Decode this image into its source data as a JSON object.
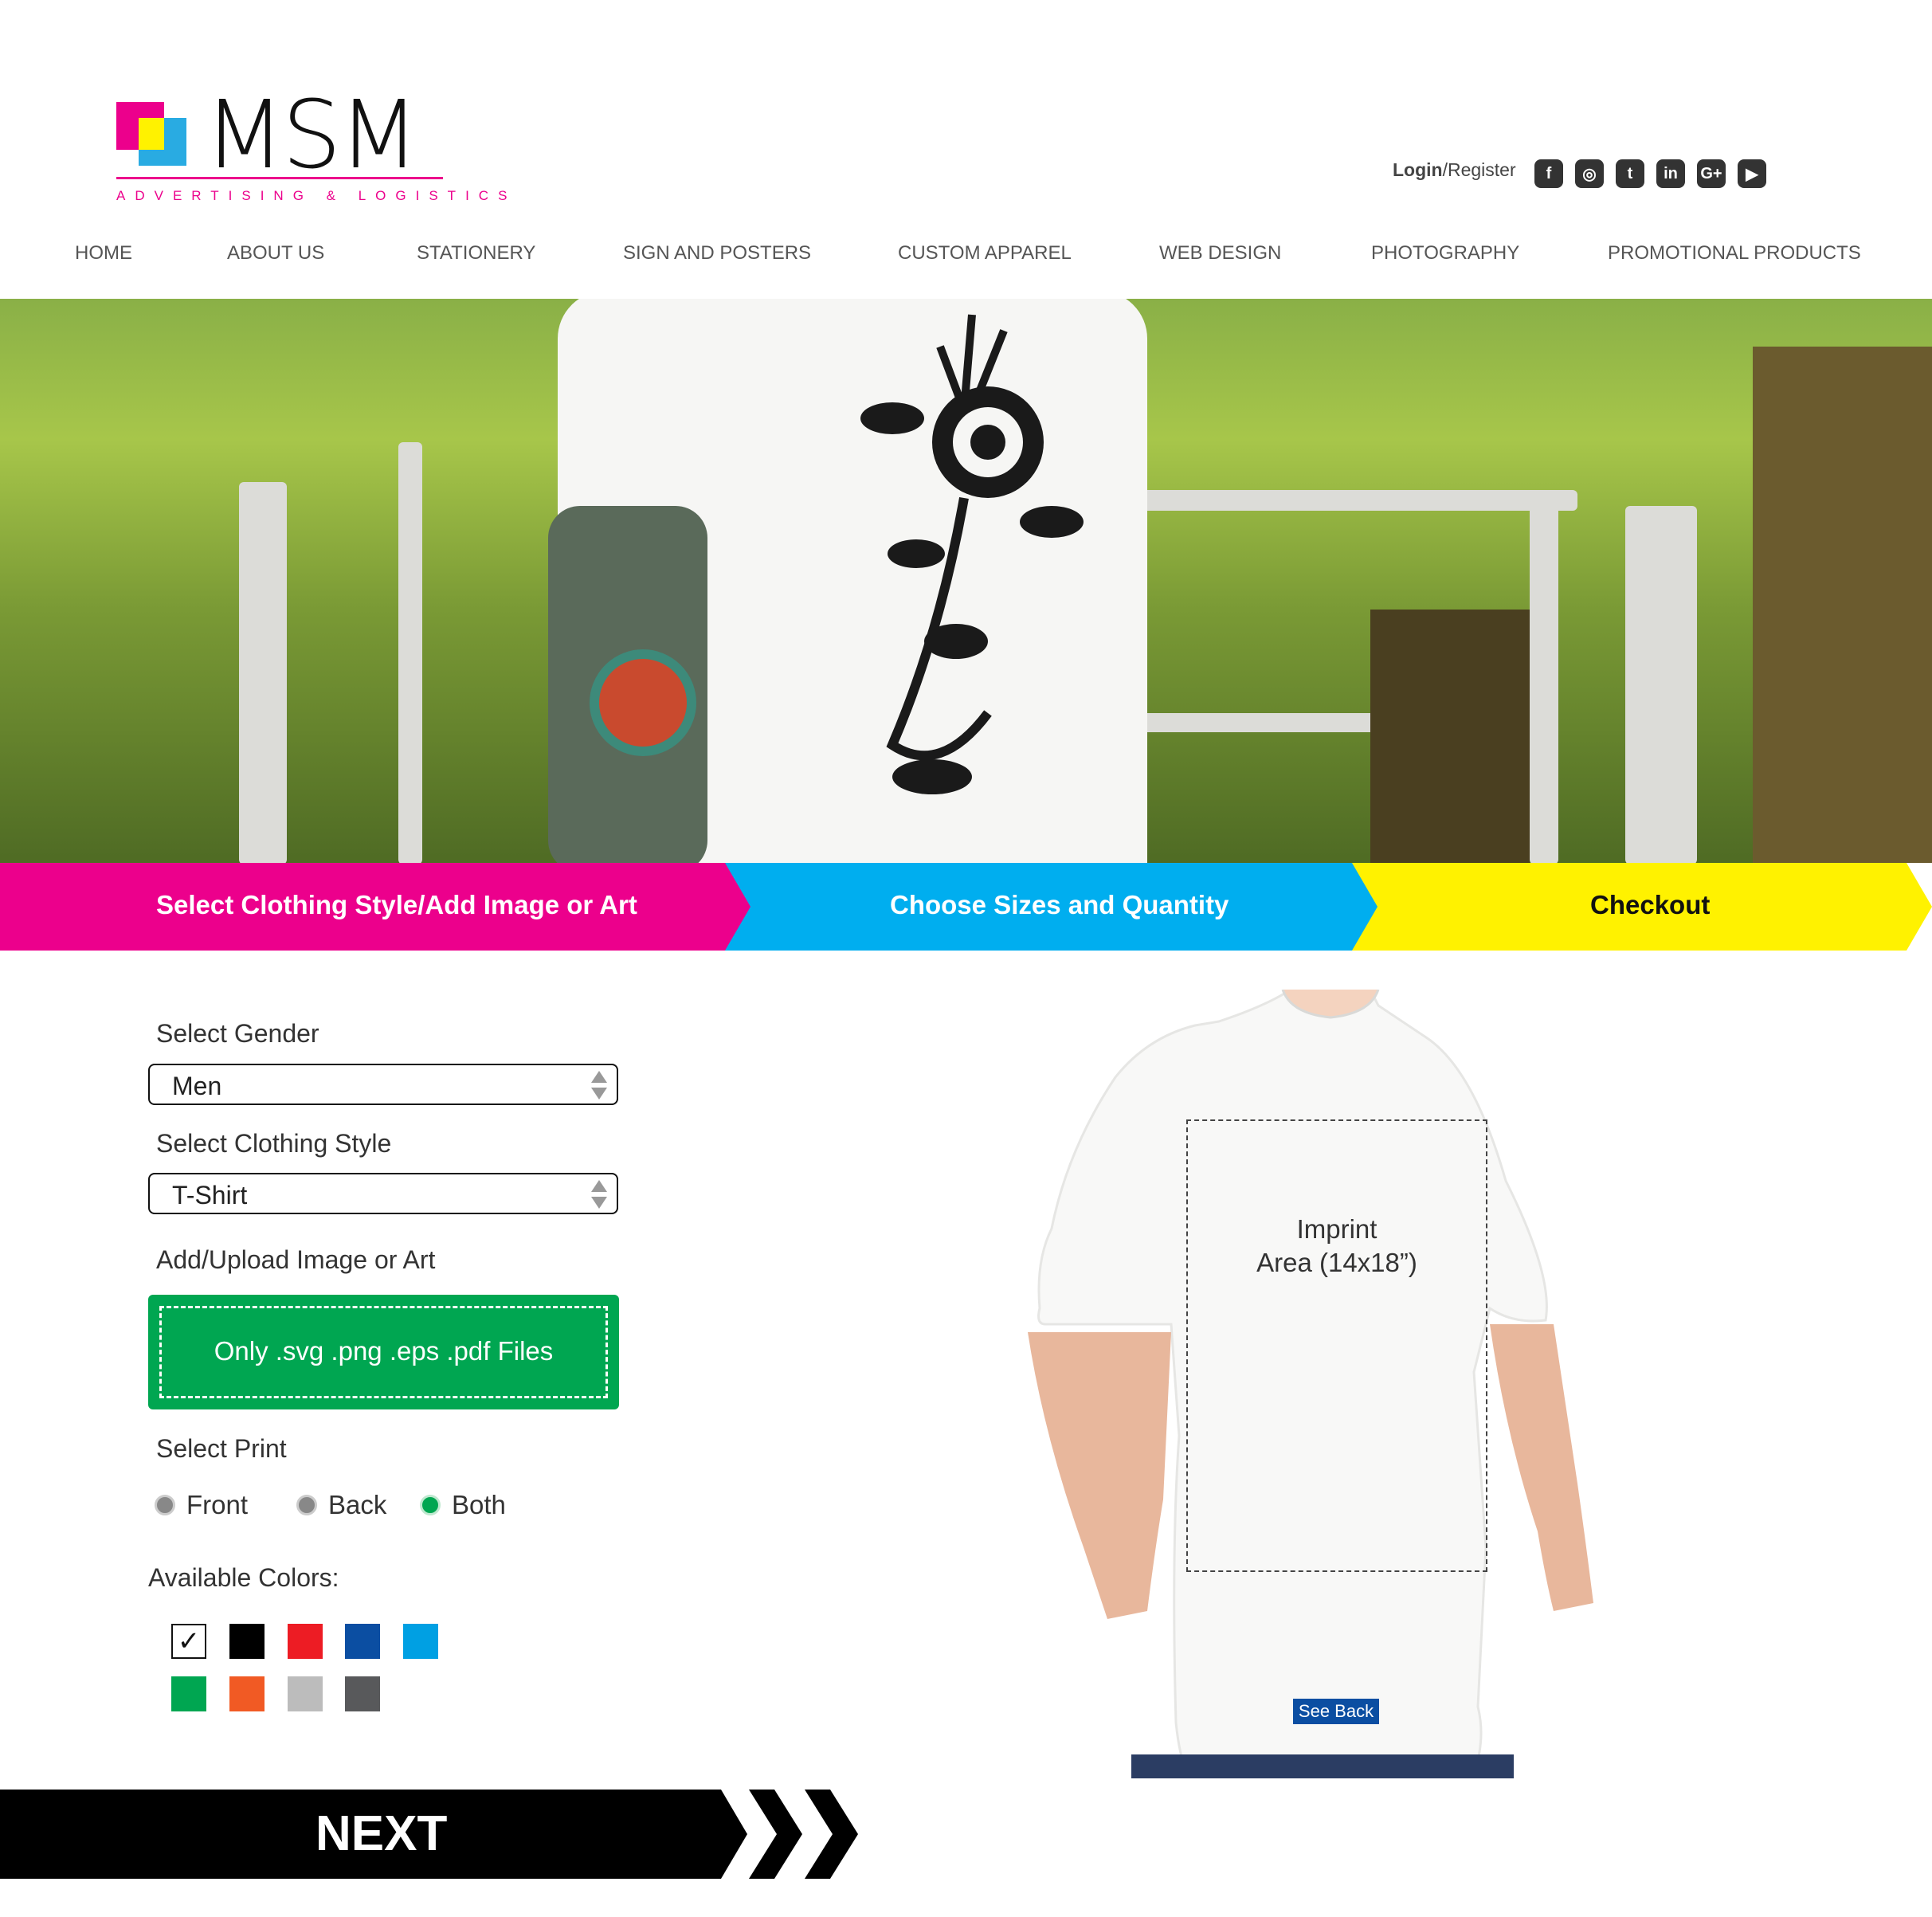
{
  "brand": {
    "name": "MSM",
    "tagline": "ADVERTISING & LOGISTICS",
    "colors": {
      "pink": "#ec008c",
      "blue": "#29abe2",
      "yellow": "#fff200"
    }
  },
  "auth": {
    "login": "Login",
    "register": "/Register"
  },
  "social": [
    {
      "name": "facebook-icon",
      "glyph": "f"
    },
    {
      "name": "instagram-icon",
      "glyph": "◎"
    },
    {
      "name": "twitter-icon",
      "glyph": "t"
    },
    {
      "name": "linkedin-icon",
      "glyph": "in"
    },
    {
      "name": "google-plus-icon",
      "glyph": "G+"
    },
    {
      "name": "youtube-icon",
      "glyph": "▶"
    }
  ],
  "nav": [
    "HOME",
    "ABOUT US",
    "STATIONERY",
    "SIGN AND POSTERS",
    "CUSTOM APPAREL",
    "WEB DESIGN",
    "PHOTOGRAPHY",
    "PROMOTIONAL PRODUCTS"
  ],
  "steps": [
    {
      "label": "Select Clothing Style/Add Image or Art",
      "color": "#ec008c",
      "text_color": "#ffffff"
    },
    {
      "label": "Choose Sizes and Quantity",
      "color": "#00aeef",
      "text_color": "#ffffff"
    },
    {
      "label": "Checkout",
      "color": "#fff200",
      "text_color": "#111111"
    }
  ],
  "form": {
    "gender_label": "Select Gender",
    "gender_value": "Men",
    "style_label": "Select Clothing Style",
    "style_value": "T-Shirt",
    "upload_label": "Add/Upload Image or Art",
    "upload_text": "Only .svg .png .eps .pdf Files",
    "print_label": "Select Print",
    "print_options": [
      "Front",
      "Back",
      "Both"
    ],
    "print_selected": "Both",
    "colors_label": "Available Colors:",
    "colors": [
      "#ffffff",
      "#000000",
      "#ed1c24",
      "#0b4ea2",
      "#00a0e3",
      "#00a651",
      "#f15a24",
      "#bcbcbc",
      "#58595b"
    ],
    "selected_color": "#ffffff",
    "check_glyph": "✓"
  },
  "product": {
    "imprint_line1": "Imprint",
    "imprint_line2": "Area (14x18”)",
    "see_back": "See Back"
  },
  "next": {
    "label": "NEXT"
  }
}
